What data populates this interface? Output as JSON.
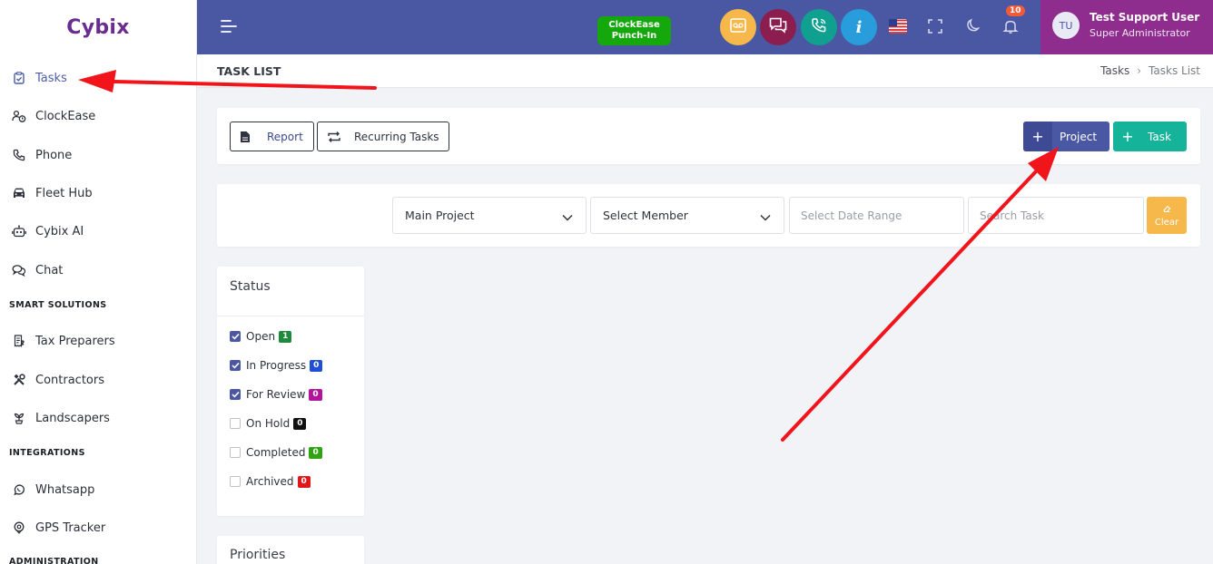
{
  "app": {
    "logo": "Cybix"
  },
  "sidebar": {
    "items": [
      {
        "label": "Tasks",
        "icon": "clipboard-check-icon"
      },
      {
        "label": "ClockEase",
        "icon": "clock-users-icon"
      },
      {
        "label": "Phone",
        "icon": "phone-icon"
      },
      {
        "label": "Fleet Hub",
        "icon": "car-icon"
      },
      {
        "label": "Cybix AI",
        "icon": "robot-icon"
      },
      {
        "label": "Chat",
        "icon": "chat-icon"
      }
    ],
    "section_smart": "SMART SOLUTIONS",
    "smart_items": [
      {
        "label": "Tax Preparers",
        "icon": "receipt-icon"
      },
      {
        "label": "Contractors",
        "icon": "tools-icon"
      },
      {
        "label": "Landscapers",
        "icon": "plant-icon"
      }
    ],
    "section_integrations": "INTEGRATIONS",
    "integration_items": [
      {
        "label": "Whatsapp",
        "icon": "whatsapp-icon"
      },
      {
        "label": "GPS Tracker",
        "icon": "gps-icon"
      }
    ],
    "section_admin": "ADMINISTRATION"
  },
  "topbar": {
    "punch_line1": "ClockEase",
    "punch_line2": "Punch-In",
    "notification_count": "10",
    "user_initials": "TU",
    "user_name": "Test Support User",
    "user_role": "Super Administrator",
    "colors": {
      "bar": "#4a57a3",
      "user": "#8e2d8e",
      "voicemail": "#f7b84b",
      "chat": "#8b1d4f",
      "call": "#10a090",
      "info": "#299cdb"
    }
  },
  "page": {
    "title": "TASK LIST",
    "breadcrumb": [
      "Tasks",
      "Tasks List"
    ]
  },
  "toolbar": {
    "report_label": "Report",
    "recurring_label": "Recurring Tasks",
    "project_label": "Project",
    "task_label": "Task"
  },
  "filters": {
    "project_select": "Main Project",
    "member_select": "Select Member",
    "date_placeholder": "Select Date Range",
    "search_placeholder": "Search Task",
    "clear_label": "Clear"
  },
  "status_panel": {
    "title": "Status",
    "items": [
      {
        "label": "Open",
        "count": "1",
        "checked": true,
        "color": "#1e8a3e"
      },
      {
        "label": "In Progress",
        "count": "0",
        "checked": true,
        "color": "#1f4fd6"
      },
      {
        "label": "For Review",
        "count": "0",
        "checked": true,
        "color": "#b4149b"
      },
      {
        "label": "On Hold",
        "count": "0",
        "checked": false,
        "color": "#111111"
      },
      {
        "label": "Completed",
        "count": "0",
        "checked": false,
        "color": "#2fa40f"
      },
      {
        "label": "Archived",
        "count": "0",
        "checked": false,
        "color": "#e0161b"
      }
    ]
  },
  "priorities_panel": {
    "title": "Priorities"
  }
}
